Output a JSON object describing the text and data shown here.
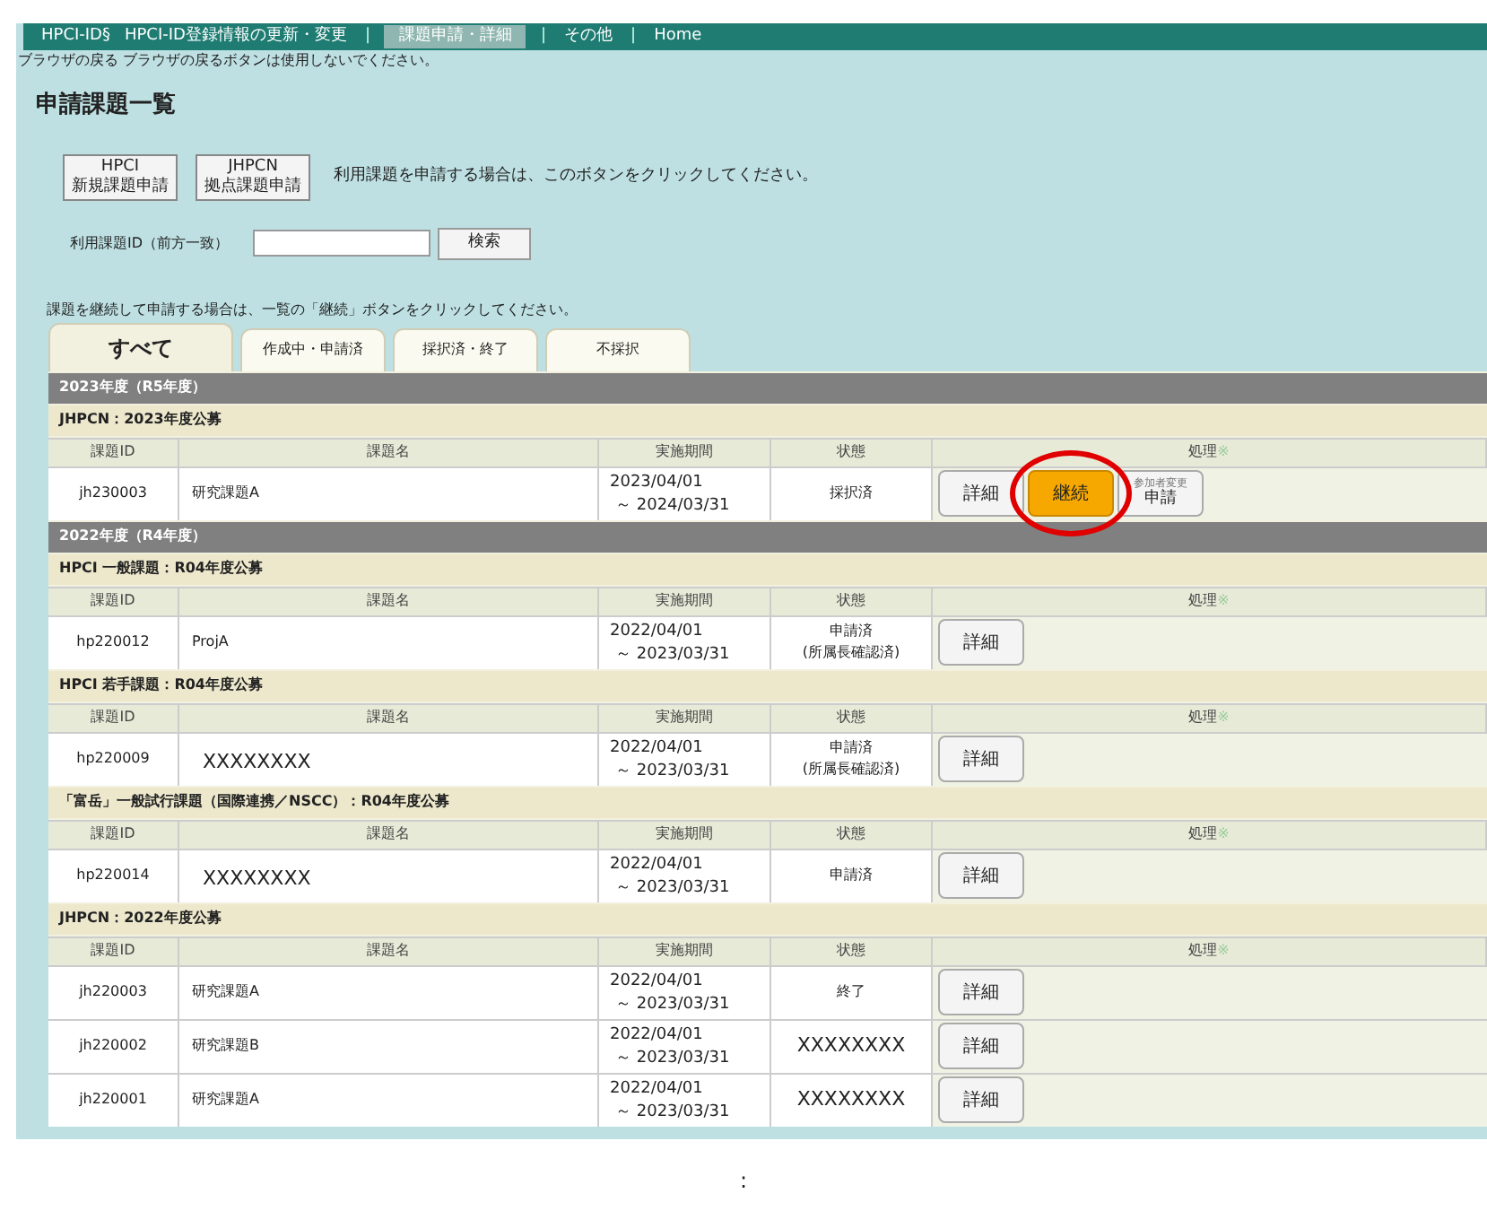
{
  "nav": [
    {
      "label": "HPCI-ID§",
      "selected": false
    },
    {
      "label": "HPCI-ID登録情報の更新・変更",
      "selected": false
    },
    {
      "separator": "|",
      "label": "課題申請・詳細",
      "selected": true
    },
    {
      "separator": "|",
      "label": "その他",
      "selected": false
    },
    {
      "separator": "|",
      "label": "Home",
      "selected": false
    }
  ],
  "notice": "ブラウザの戻る ブラウザの戻るボタンは使用しないでください。",
  "title": "申請課題一覧",
  "new_buttons": [
    {
      "line1": "HPCI",
      "line2": "新規課題申請"
    },
    {
      "line1": "JHPCN",
      "line2": "拠点課題申請"
    }
  ],
  "new_hint": "利用課題を申請する場合は、このボタンをクリックしてください。",
  "search": {
    "label": "利用課題ID（前方一致）",
    "button": "検索"
  },
  "continue_hint": "課題を継続して申請する場合は、一覧の「継続」ボタンをクリックしてください。",
  "tabs": [
    {
      "label": "すべて",
      "selected": true
    },
    {
      "label": "作成中・申請済",
      "selected": false
    },
    {
      "label": "採択済・終了",
      "selected": false
    },
    {
      "label": "不採択",
      "selected": false
    }
  ],
  "years": [
    {
      "title": "2023年度（R5年度）",
      "sections": [
        {
          "title": "JHPCN：2023年度公募",
          "columns": [
            "課題ID",
            "課題名",
            "実施期間",
            "状態",
            "処理"
          ],
          "note_mark": "※",
          "rows": [
            {
              "id": "jh230003",
              "name": "研究課題A",
              "start": "2023/04/01",
              "end": "～ 2024/03/31",
              "status": [
                "採択済"
              ],
              "actions": [
                {
                  "kind": "detail",
                  "label": "詳細"
                },
                {
                  "kind": "continue",
                  "label": "継続",
                  "highlighted": true
                },
                {
                  "kind": "change",
                  "small": "参加者変更",
                  "label": "申請"
                }
              ]
            }
          ]
        }
      ]
    },
    {
      "title": "2022年度（R4年度）",
      "sections": [
        {
          "title": "HPCI 一般課題：R04年度公募",
          "columns": [
            "課題ID",
            "課題名",
            "実施期間",
            "状態",
            "処理"
          ],
          "note_mark": "※",
          "rows": [
            {
              "id": "hp220012",
              "name": "ProjA",
              "start": "2022/04/01",
              "end": "～ 2023/03/31",
              "status": [
                "申請済",
                "(所属長確認済)"
              ],
              "actions": [
                {
                  "kind": "detail",
                  "label": "詳細"
                }
              ]
            }
          ]
        },
        {
          "title": "HPCI 若手課題：R04年度公募",
          "columns": [
            "課題ID",
            "課題名",
            "実施期間",
            "状態",
            "処理"
          ],
          "note_mark": "※",
          "rows": [
            {
              "id": "hp220009",
              "name": "XXXXXXXX",
              "masked": true,
              "start": "2022/04/01",
              "end": "～ 2023/03/31",
              "status": [
                "申請済",
                "(所属長確認済)"
              ],
              "actions": [
                {
                  "kind": "detail",
                  "label": "詳細"
                }
              ]
            }
          ]
        },
        {
          "title": "「富岳」一般試行課題（国際連携／NSCC）：R04年度公募",
          "columns": [
            "課題ID",
            "課題名",
            "実施期間",
            "状態",
            "処理"
          ],
          "note_mark": "※",
          "rows": [
            {
              "id": "hp220014",
              "name": "XXXXXXXX",
              "masked": true,
              "start": "2022/04/01",
              "end": "～ 2023/03/31",
              "status": [
                "申請済"
              ],
              "actions": [
                {
                  "kind": "detail",
                  "label": "詳細"
                }
              ]
            }
          ]
        },
        {
          "title": "JHPCN：2022年度公募",
          "columns": [
            "課題ID",
            "課題名",
            "実施期間",
            "状態",
            "処理"
          ],
          "note_mark": "※",
          "rows": [
            {
              "id": "jh220003",
              "name": "研究課題A",
              "start": "2022/04/01",
              "end": "～ 2023/03/31",
              "status": [
                "終了"
              ],
              "actions": [
                {
                  "kind": "detail",
                  "label": "詳細"
                }
              ]
            },
            {
              "id": "jh220002",
              "name": "研究課題B",
              "start": "2022/04/01",
              "end": "～ 2023/03/31",
              "status": [
                "XXXXXXXX"
              ],
              "status_masked": true,
              "actions": [
                {
                  "kind": "detail",
                  "label": "詳細"
                }
              ]
            },
            {
              "id": "jh220001",
              "name": "研究課題A",
              "start": "2022/04/01",
              "end": "～ 2023/03/31",
              "status": [
                "XXXXXXXX"
              ],
              "status_masked": true,
              "actions": [
                {
                  "kind": "detail",
                  "label": "詳細"
                }
              ]
            }
          ]
        }
      ]
    }
  ],
  "continuation": ":"
}
